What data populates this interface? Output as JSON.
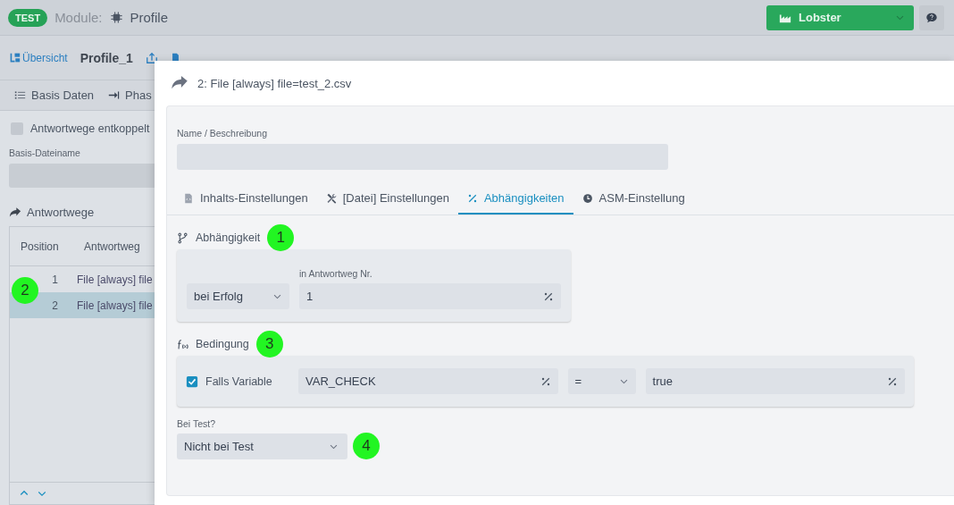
{
  "header": {
    "badge": "TEST",
    "module_label": "Module:",
    "module_name": "Profile",
    "account_menu": {
      "label": "Lobster"
    }
  },
  "breadcrumb": {
    "overview_link": "Übersicht",
    "profile_name": "Profile_1"
  },
  "section_tabs": [
    {
      "label": "Basis Daten",
      "selected": false
    },
    {
      "label": "Phas",
      "selected": false
    }
  ],
  "left_panel": {
    "decouple_checkbox": {
      "label": "Antwortwege entkoppelt",
      "checked": false
    },
    "base_filename": {
      "label": "Basis-Dateiname"
    },
    "routes_title": "Antwortwege",
    "table": {
      "columns": [
        "Position",
        "Antwortweg"
      ],
      "marker": "2",
      "rows": [
        {
          "cells": [
            "1",
            "File [always] file"
          ],
          "selected": false
        },
        {
          "cells": [
            "2",
            "File [always] file"
          ],
          "selected": true
        }
      ]
    }
  },
  "dialog": {
    "title": "2: File [always] file=test_2.csv",
    "name_field": {
      "label": "Name / Beschreibung"
    },
    "tabs": [
      {
        "label": "Inhalts-Einstellungen",
        "kind": "file",
        "selected": false
      },
      {
        "label": "[Datei] Einstellungen",
        "kind": "tools",
        "selected": false
      },
      {
        "label": "Abhängigkeiten",
        "kind": "percent",
        "selected": true
      },
      {
        "label": "ASM-Einstellung",
        "kind": "clock",
        "selected": false
      }
    ],
    "dependency": {
      "title": "Abhängigkeit",
      "marker": "1",
      "condition_select": {
        "value": "bei Erfolg"
      },
      "route_field": {
        "label": "in Antwortweg Nr.",
        "value": "1"
      }
    },
    "condition": {
      "title": "Bedingung",
      "marker": "3",
      "checkbox": {
        "label": "Falls Variable",
        "checked": true
      },
      "variable_field": {
        "value": "VAR_CHECK"
      },
      "operator_select": {
        "value": "="
      },
      "value_field": {
        "value": "true"
      }
    },
    "test": {
      "label": "Bei Test?",
      "marker": "4",
      "select": {
        "value": "Nicht bei Test"
      }
    }
  }
}
